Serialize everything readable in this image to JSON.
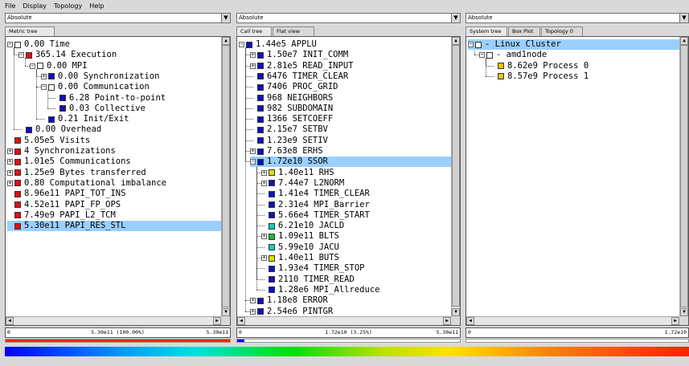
{
  "menu": [
    "File",
    "Display",
    "Topology",
    "Help"
  ],
  "panels": [
    {
      "combo": "Absolute",
      "tabs": [
        "Metric tree"
      ],
      "status": {
        "left": "0",
        "center": "5.30e11 (100.00%)",
        "right": "5.30e11"
      },
      "bar_fraction": 1.0,
      "bar_color": "#ff2000",
      "rows": [
        {
          "level": 0,
          "exp": "-",
          "color": "#ffffff",
          "text": "0.00 Time"
        },
        {
          "level": 1,
          "exp": "-",
          "color": "#e01010",
          "text": "365.14 Execution"
        },
        {
          "level": 2,
          "exp": "-",
          "color": "#ffffff",
          "text": "0.00 MPI"
        },
        {
          "level": 3,
          "exp": "+",
          "color": "#1010c0",
          "text": "0.00 Synchronization"
        },
        {
          "level": 3,
          "exp": "-",
          "color": "#ffffff",
          "text": "0.00 Communication"
        },
        {
          "level": 4,
          "exp": "",
          "color": "#1010c0",
          "text": "6.28 Point-to-point"
        },
        {
          "level": 4,
          "exp": "",
          "color": "#1010c0",
          "text": "0.03 Collective"
        },
        {
          "level": 3,
          "exp": "",
          "color": "#1010c0",
          "text": "0.21 Init/Exit"
        },
        {
          "level": 1,
          "exp": "",
          "color": "#1010c0",
          "text": "0.00 Overhead"
        },
        {
          "level": 0,
          "exp": "",
          "color": "#e01010",
          "text": "5.05e5 Visits"
        },
        {
          "level": 0,
          "exp": "+",
          "color": "#e01010",
          "text": "4 Synchronizations"
        },
        {
          "level": 0,
          "exp": "+",
          "color": "#e01010",
          "text": "1.01e5 Communications"
        },
        {
          "level": 0,
          "exp": "+",
          "color": "#e01010",
          "text": "1.25e9 Bytes transferred"
        },
        {
          "level": 0,
          "exp": "+",
          "color": "#e01010",
          "text": "0.80 Computational imbalance"
        },
        {
          "level": 0,
          "exp": "",
          "color": "#e01010",
          "text": "8.96e11 PAPI_TOT_INS"
        },
        {
          "level": 0,
          "exp": "",
          "color": "#e01010",
          "text": "4.52e11 PAPI_FP_OPS"
        },
        {
          "level": 0,
          "exp": "",
          "color": "#e01010",
          "text": "7.49e9 PAPI_L2_TCM"
        },
        {
          "level": 0,
          "exp": "",
          "color": "#e01010",
          "text": "5.30e11 PAPI_RES_STL",
          "selected": true
        }
      ]
    },
    {
      "combo": "Absolute",
      "tabs": [
        "Call tree",
        "Flat view"
      ],
      "status": {
        "left": "0",
        "center": "1.72e10 (3.25%)",
        "right": "5.30e11"
      },
      "bar_fraction": 0.0325,
      "bar_color": "#0000ff",
      "rows": [
        {
          "level": 0,
          "exp": "-",
          "color": "#1010c0",
          "text": "1.44e5 APPLU"
        },
        {
          "level": 1,
          "exp": "+",
          "color": "#1010c0",
          "text": "1.50e7 INIT_COMM"
        },
        {
          "level": 1,
          "exp": "+",
          "color": "#1010c0",
          "text": "2.81e5 READ_INPUT"
        },
        {
          "level": 1,
          "exp": "",
          "color": "#1010c0",
          "text": "6476 TIMER_CLEAR"
        },
        {
          "level": 1,
          "exp": "",
          "color": "#1010c0",
          "text": "7406 PROC_GRID"
        },
        {
          "level": 1,
          "exp": "",
          "color": "#1010c0",
          "text": "968 NEIGHBORS"
        },
        {
          "level": 1,
          "exp": "",
          "color": "#1010c0",
          "text": "982 SUBDOMAIN"
        },
        {
          "level": 1,
          "exp": "",
          "color": "#1010c0",
          "text": "1366 SETCOEFF"
        },
        {
          "level": 1,
          "exp": "",
          "color": "#1010c0",
          "text": "2.15e7 SETBV"
        },
        {
          "level": 1,
          "exp": "",
          "color": "#1010c0",
          "text": "1.23e9 SETIV"
        },
        {
          "level": 1,
          "exp": "+",
          "color": "#1010c0",
          "text": "7.63e8 ERHS"
        },
        {
          "level": 1,
          "exp": "-",
          "color": "#1010c0",
          "text": "1.72e10 SSOR",
          "selected": true
        },
        {
          "level": 2,
          "exp": "+",
          "color": "#d8e000",
          "text": "1.40e11 RHS"
        },
        {
          "level": 2,
          "exp": "+",
          "color": "#1010c0",
          "text": "7.44e7 L2NORM"
        },
        {
          "level": 2,
          "exp": "",
          "color": "#1010c0",
          "text": "1.41e4 TIMER_CLEAR"
        },
        {
          "level": 2,
          "exp": "",
          "color": "#1010c0",
          "text": "2.31e4 MPI_Barrier"
        },
        {
          "level": 2,
          "exp": "",
          "color": "#1010c0",
          "text": "5.66e4 TIMER_START"
        },
        {
          "level": 2,
          "exp": "",
          "color": "#10d0c0",
          "text": "6.21e10 JACLD"
        },
        {
          "level": 2,
          "exp": "+",
          "color": "#10c040",
          "text": "1.09e11 BLTS"
        },
        {
          "level": 2,
          "exp": "",
          "color": "#10d0c0",
          "text": "5.99e10 JACU"
        },
        {
          "level": 2,
          "exp": "+",
          "color": "#d8e000",
          "text": "1.40e11 BUTS"
        },
        {
          "level": 2,
          "exp": "",
          "color": "#1010c0",
          "text": "1.93e4 TIMER_STOP"
        },
        {
          "level": 2,
          "exp": "",
          "color": "#1010c0",
          "text": "2110 TIMER_READ"
        },
        {
          "level": 2,
          "exp": "",
          "color": "#1010c0",
          "text": "1.28e6 MPI_Allreduce"
        },
        {
          "level": 1,
          "exp": "+",
          "color": "#1010c0",
          "text": "1.18e8 ERROR"
        },
        {
          "level": 1,
          "exp": "+",
          "color": "#1010c0",
          "text": "2.54e6 PINTGR"
        }
      ]
    },
    {
      "combo": "Absolute",
      "tabs": [
        "System tree",
        "Box Plot",
        "Topology 0"
      ],
      "status": {
        "left": "0",
        "center": "",
        "right": "1.72e10"
      },
      "bar_fraction": 0,
      "bar_color": "#ffd000",
      "rows": [
        {
          "level": 0,
          "exp": "-",
          "color": "#ffffff",
          "text": "- Linux Cluster",
          "selected": true
        },
        {
          "level": 1,
          "exp": "-",
          "color": "#ffffff",
          "text": "- amd1node"
        },
        {
          "level": 2,
          "exp": "",
          "color": "#f0c000",
          "text": "8.62e9 Process 0"
        },
        {
          "level": 2,
          "exp": "",
          "color": "#f0c000",
          "text": "8.57e9 Process 1"
        }
      ]
    }
  ]
}
